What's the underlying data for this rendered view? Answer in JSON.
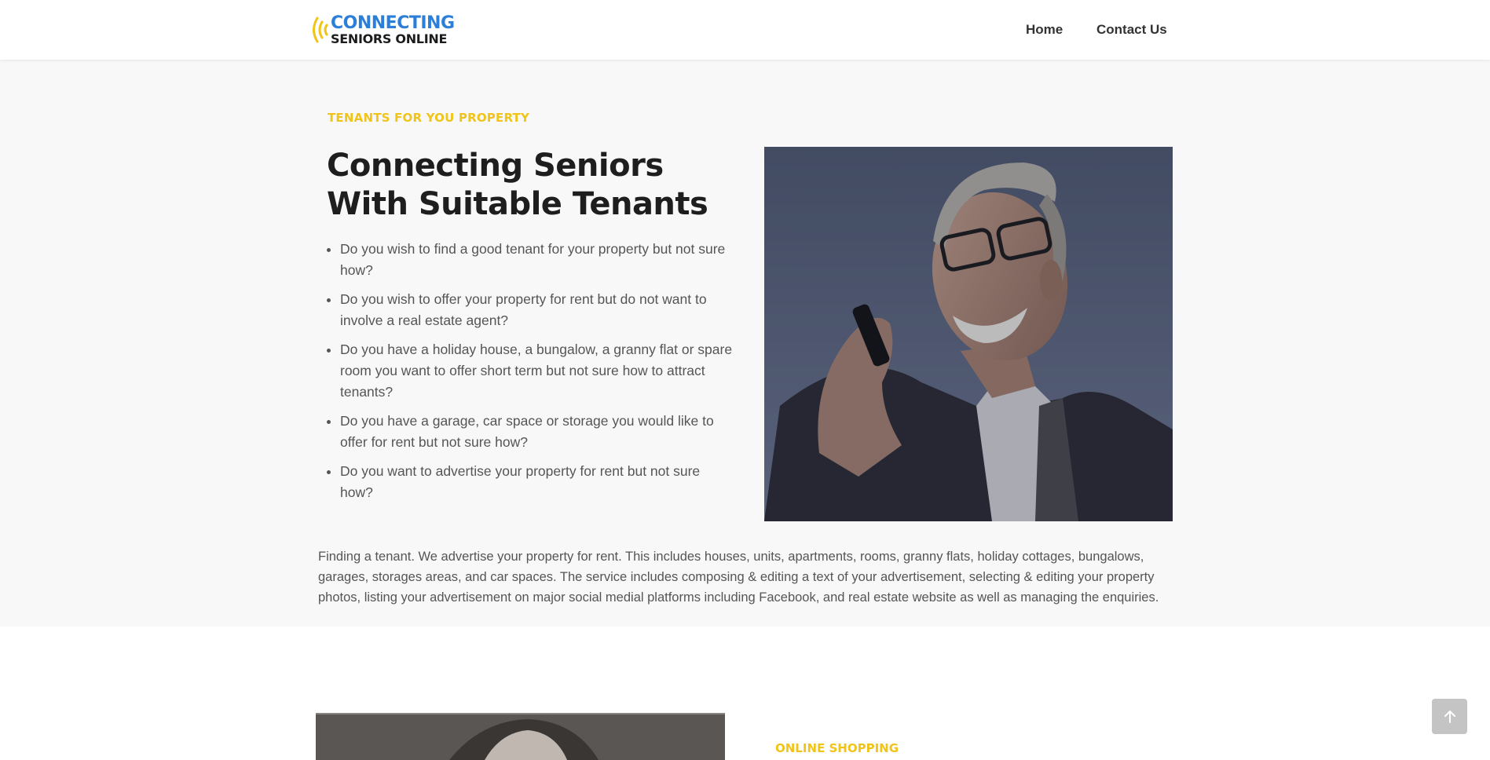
{
  "header": {
    "logo": {
      "line1": "CONNECTING",
      "line2": "SENIORS ONLINE"
    },
    "nav": [
      {
        "label": "Home"
      },
      {
        "label": "Contact Us"
      }
    ]
  },
  "section1": {
    "eyebrow": "TENANTS FOR YOU PROPERTY",
    "headline": "Connecting Seniors With Suitable Tenants",
    "bullets": [
      "Do you wish to find a good tenant for your property but not sure how?",
      "Do you wish to offer your property for rent but do not want to involve a real estate agent?",
      "Do you have a holiday house, a bungalow, a granny flat or spare room you want to offer short term but not sure how to attract tenants?",
      "Do you have a garage, car space or storage you would like to offer for rent but not sure how?",
      "Do you want to advertise your property for rent but not sure how?"
    ],
    "description": "Finding a tenant. We advertise your property for rent. This includes houses, units, apartments, rooms, granny flats, holiday cottages, bungalows, garages, storages areas, and car spaces. The service includes composing & editing a text of your advertisement, selecting & editing your property photos, listing your advertisement on major social medial platforms including Facebook, and real estate website as well as managing the enquiries."
  },
  "section2": {
    "eyebrow": "ONLINE SHOPPING"
  },
  "colors": {
    "accent_yellow": "#f0c419",
    "logo_blue": "#2b7fd8",
    "section_bg": "#f8f8f8"
  },
  "icons": {
    "logo": "sound-waves-icon",
    "back_to_top": "arrow-up-icon"
  }
}
